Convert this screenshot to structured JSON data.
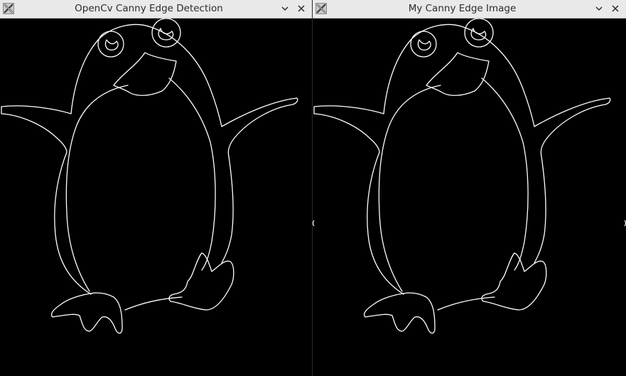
{
  "windows": [
    {
      "title": "OpenCv Canny Edge Detection",
      "icon": "x11-app-icon",
      "buttons": [
        "minimize-chevron-icon",
        "close-icon"
      ]
    },
    {
      "title": "My Canny Edge Image",
      "icon": "x11-app-icon",
      "buttons": [
        "minimize-chevron-icon",
        "close-icon"
      ]
    }
  ],
  "image": {
    "description_colors": {
      "background": "#000000",
      "edges": "#ffffff"
    }
  }
}
